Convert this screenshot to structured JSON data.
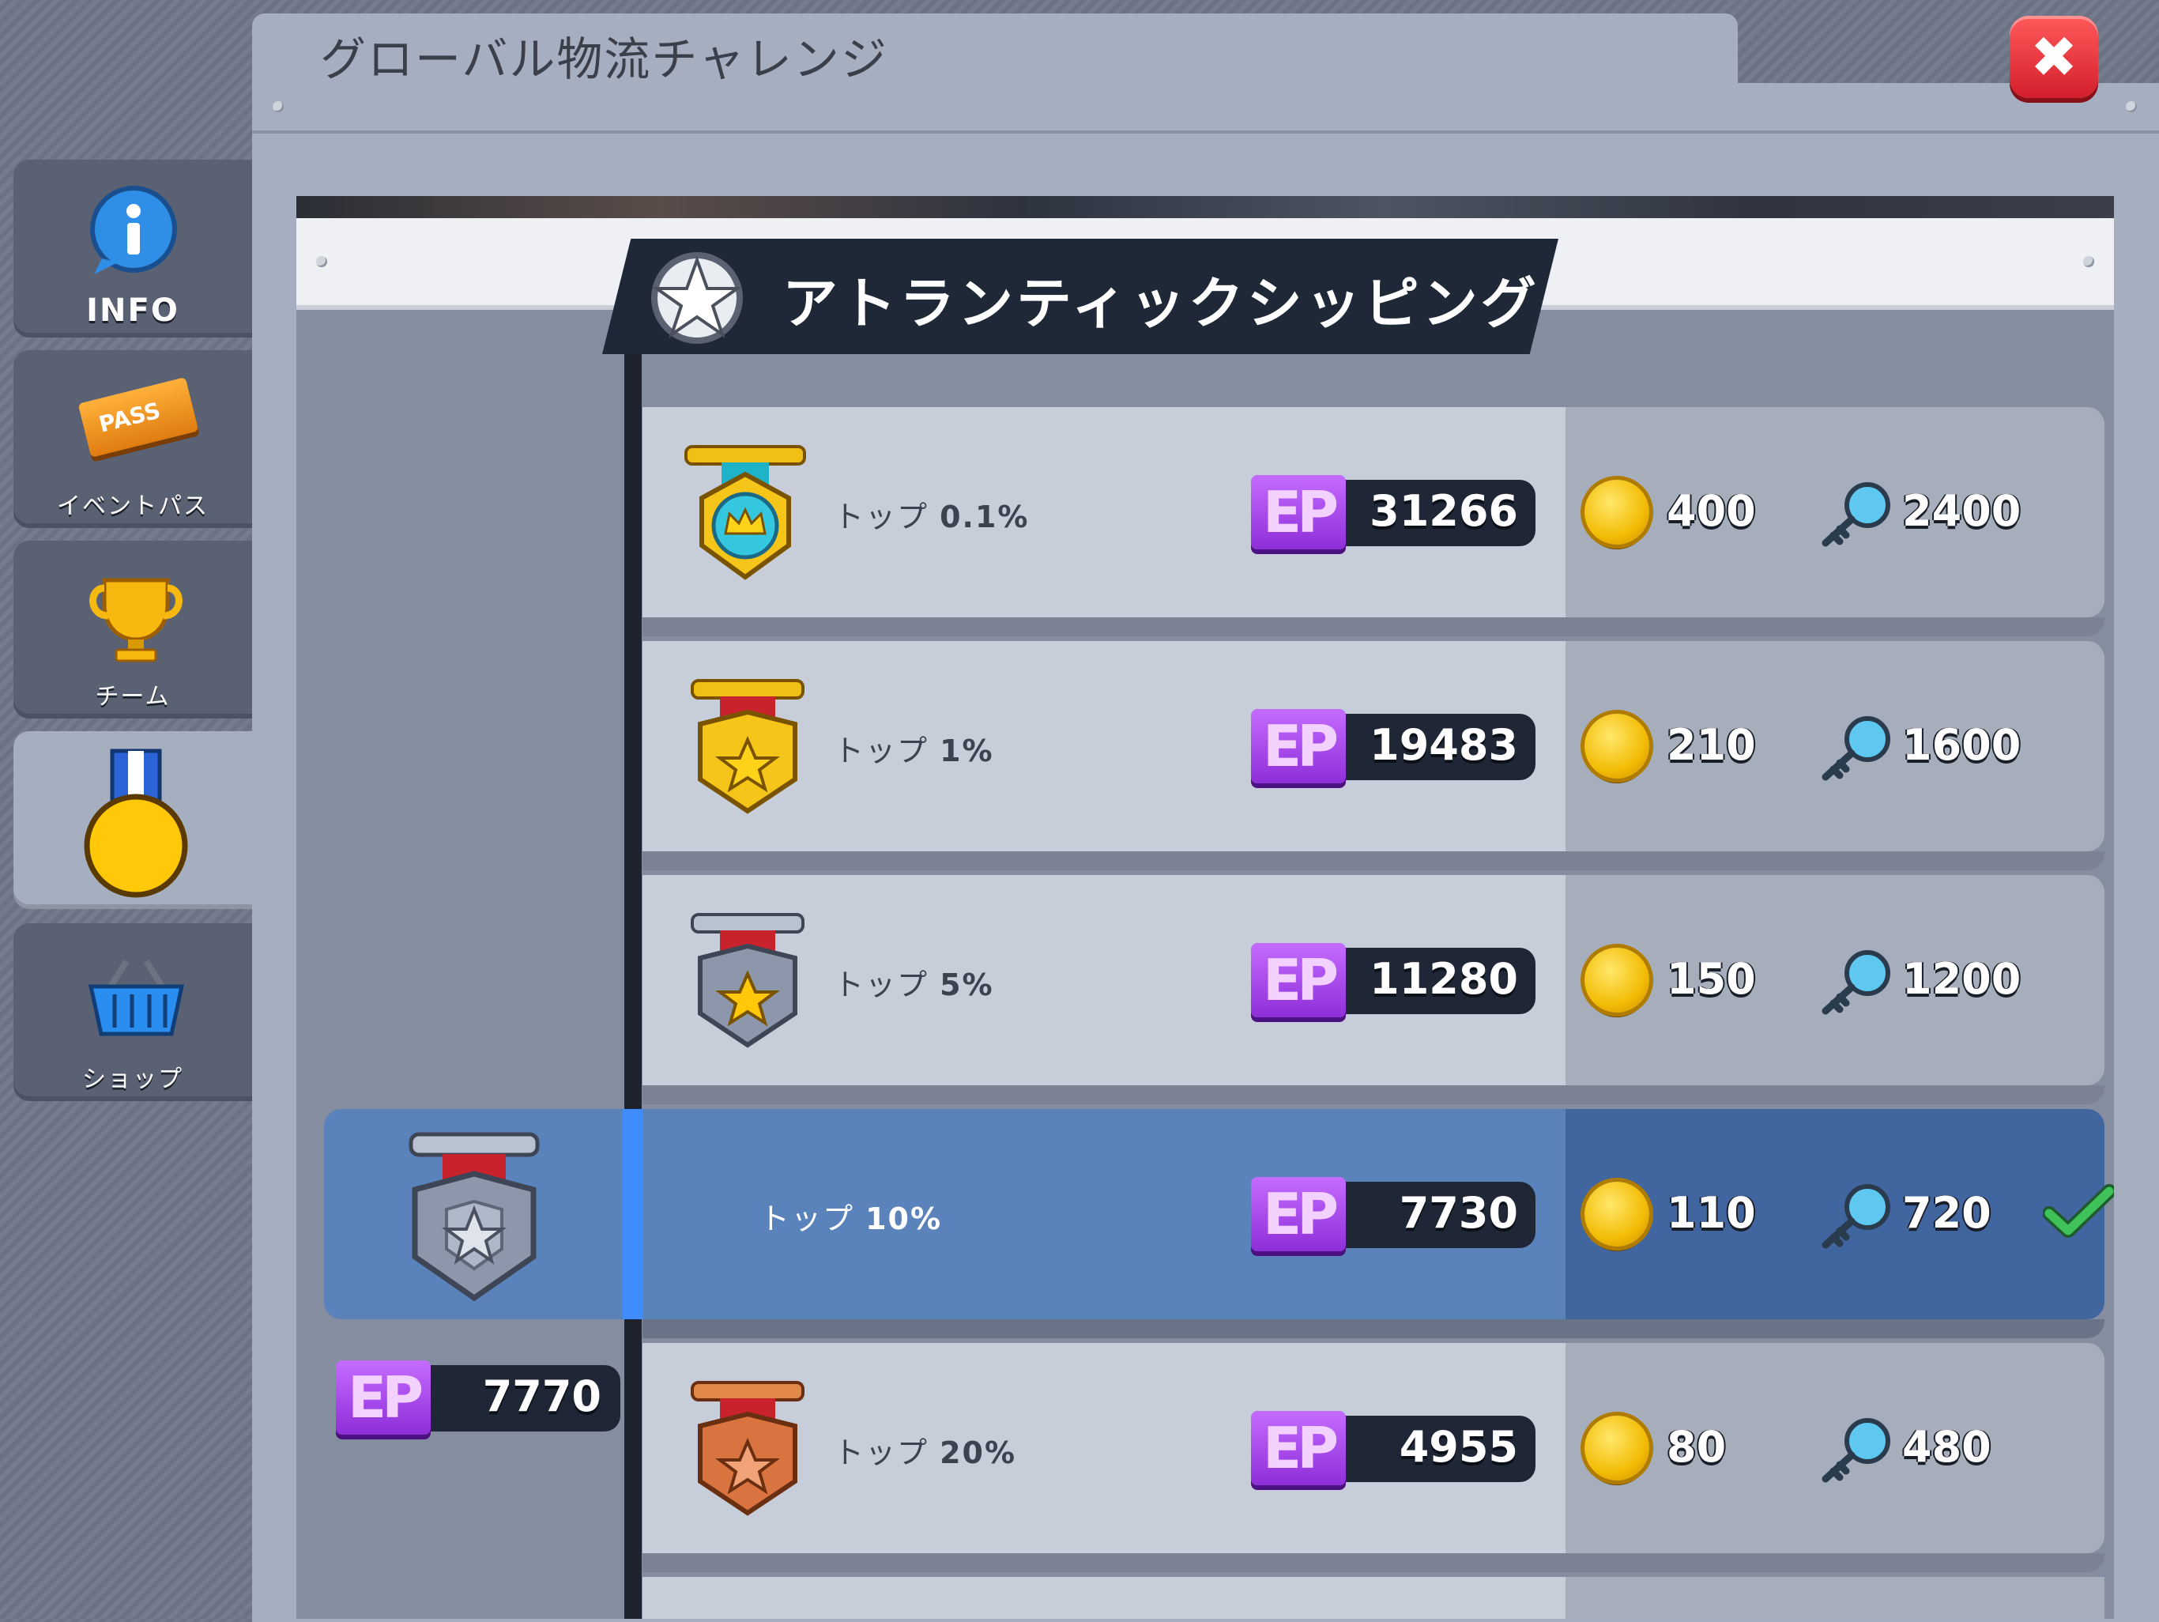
{
  "window": {
    "title": "グローバル物流チャレンジ",
    "close_label": "✖"
  },
  "sidebar": {
    "items": [
      {
        "label": "INFO",
        "icon": "info-icon"
      },
      {
        "label": "イベントパス",
        "icon": "event-pass-icon",
        "icon_text": "PASS"
      },
      {
        "label": "チーム",
        "icon": "trophy-icon"
      },
      {
        "label": "",
        "icon": "medal-icon",
        "active": true
      },
      {
        "label": "ショップ",
        "icon": "shop-basket-icon"
      }
    ]
  },
  "league": {
    "name": "アトランティックシッピング"
  },
  "rewards": {
    "ep_logo": "EP",
    "rows": [
      {
        "rank_prefix": "トップ ",
        "rank_value": "0.1%",
        "ep": "31266",
        "coins": "400",
        "keys": "2400",
        "medal": "crown"
      },
      {
        "rank_prefix": "トップ ",
        "rank_value": "1%",
        "ep": "19483",
        "coins": "210",
        "keys": "1600",
        "medal": "gold"
      },
      {
        "rank_prefix": "トップ ",
        "rank_value": "5%",
        "ep": "11280",
        "coins": "150",
        "keys": "1200",
        "medal": "silver-gold-star"
      },
      {
        "rank_prefix": "トップ ",
        "rank_value": "10%",
        "ep": "7730",
        "coins": "110",
        "keys": "720",
        "medal": "silver",
        "current": true
      },
      {
        "rank_prefix": "トップ ",
        "rank_value": "20%",
        "ep": "4955",
        "coins": "80",
        "keys": "480",
        "medal": "bronze"
      }
    ]
  },
  "player": {
    "ep": "7770"
  },
  "colors": {
    "ep_purple": "#a84ef0",
    "current_row": "#5a83bb",
    "close_red": "#e8303b",
    "check_green": "#2ea84a"
  }
}
